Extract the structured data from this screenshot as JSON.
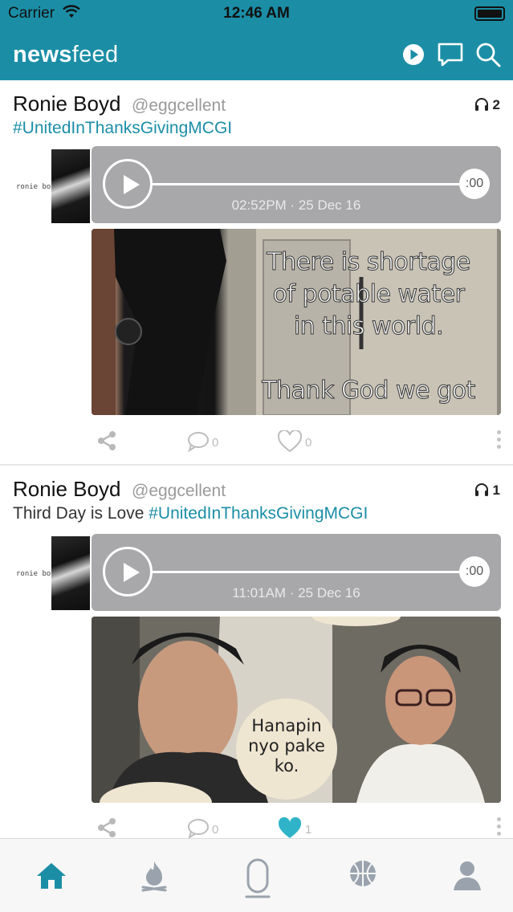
{
  "status_bar": {
    "carrier": "Carrier",
    "time": "12:46 AM"
  },
  "header": {
    "title_bold": "news",
    "title_light": "feed"
  },
  "nav_icons": [
    "play-circle-icon",
    "chat-bubble-icon",
    "search-icon"
  ],
  "posts": [
    {
      "author": "Ronie Boyd",
      "handle": "@eggcellent",
      "listens": "2",
      "caption_text": "",
      "caption_tag": "#UnitedInThanksGivingMCGI",
      "avatar_text": "ronie boyd",
      "audio": {
        "duration": ":00",
        "timestamp": "02:52PM · 25 Dec 16"
      },
      "image_text_lines": [
        "There is shortage",
        "of potable water",
        "in this world.",
        "Thank God we got"
      ],
      "comments": "0",
      "likes": "0",
      "liked": false
    },
    {
      "author": "Ronie Boyd",
      "handle": "@eggcellent",
      "listens": "1",
      "caption_text": "Third Day is Love ",
      "caption_tag": "#UnitedInThanksGivingMCGI",
      "avatar_text": "ronie boyd",
      "audio": {
        "duration": ":00",
        "timestamp": "11:01AM · 25 Dec 16"
      },
      "image_text_lines": [
        "Hanapin",
        "nyo pake",
        "ko."
      ],
      "comments": "0",
      "likes": "1",
      "liked": true
    }
  ],
  "tab_bar": [
    "home-icon",
    "fire-icon",
    "microphone-icon",
    "basketball-icon",
    "profile-icon"
  ],
  "colors": {
    "accent": "#1b8ea6",
    "player_bg": "#a8a8aa",
    "tab_inactive": "#9aa3ad"
  }
}
